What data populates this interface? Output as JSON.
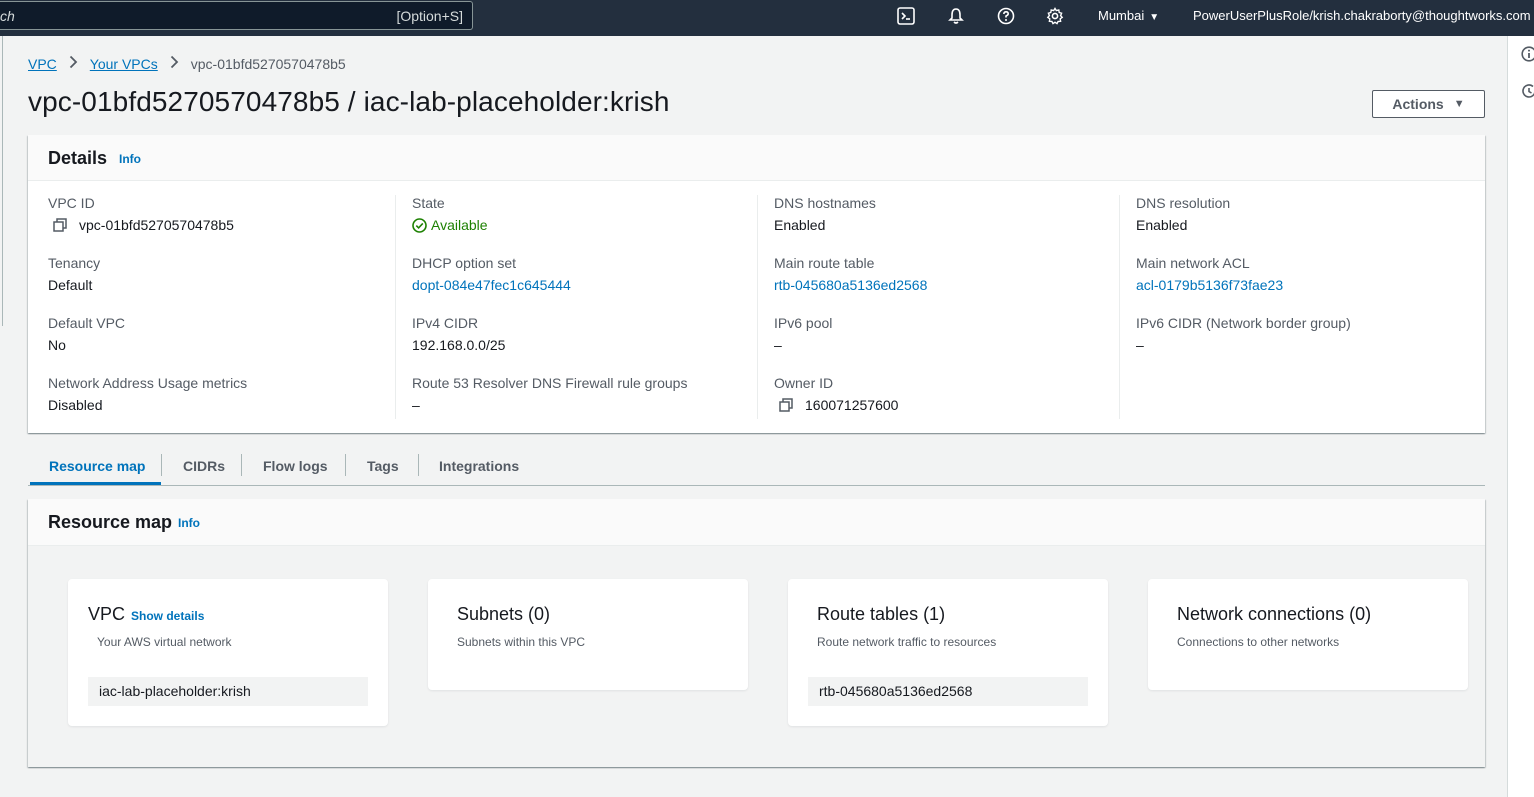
{
  "topnav": {
    "search_text": "ch",
    "search_shortcut": "[Option+S]",
    "region": "Mumbai",
    "account": "PowerUserPlusRole/krish.chakraborty@thoughtworks.com",
    "icons": [
      "cloudshell-icon",
      "bell-icon",
      "help-icon",
      "settings-icon"
    ]
  },
  "breadcrumb": {
    "items": [
      {
        "label": "VPC"
      },
      {
        "label": "Your VPCs"
      },
      {
        "label": "vpc-01bfd5270570478b5"
      }
    ]
  },
  "page": {
    "title": "vpc-01bfd5270570478b5 / iac-lab-placeholder:krish",
    "actions_label": "Actions"
  },
  "details": {
    "title": "Details",
    "info": "Info",
    "columns": [
      [
        {
          "label": "VPC ID",
          "value": "vpc-01bfd5270570478b5"
        },
        {
          "label": "Tenancy",
          "value": "Default"
        },
        {
          "label": "Default VPC",
          "value": "No"
        },
        {
          "label": "Network Address Usage metrics",
          "value": "Disabled"
        }
      ],
      [
        {
          "label": "State",
          "value": "Available"
        },
        {
          "label": "DHCP option set",
          "value": "dopt-084e47fec1c645444"
        },
        {
          "label": "IPv4 CIDR",
          "value": "192.168.0.0/25"
        },
        {
          "label": "Route 53 Resolver DNS Firewall rule groups",
          "value": "–"
        }
      ],
      [
        {
          "label": "DNS hostnames",
          "value": "Enabled"
        },
        {
          "label": "Main route table",
          "value": "rtb-045680a5136ed2568"
        },
        {
          "label": "IPv6 pool",
          "value": "–"
        },
        {
          "label": "Owner ID",
          "value": "160071257600"
        }
      ],
      [
        {
          "label": "DNS resolution",
          "value": "Enabled"
        },
        {
          "label": "Main network ACL",
          "value": "acl-0179b5136f73fae23"
        },
        {
          "label": "IPv6 CIDR (Network border group)",
          "value": "–"
        }
      ]
    ]
  },
  "tabs": [
    {
      "label": "Resource map"
    },
    {
      "label": "CIDRs"
    },
    {
      "label": "Flow logs"
    },
    {
      "label": "Tags"
    },
    {
      "label": "Integrations"
    }
  ],
  "resource_map": {
    "title": "Resource map",
    "info": "Info",
    "cards": [
      {
        "title": "VPC",
        "link": "Show details",
        "subtitle": "Your AWS virtual network",
        "chip": "iac-lab-placeholder:krish"
      },
      {
        "title": "Subnets (0)",
        "subtitle": "Subnets within this VPC"
      },
      {
        "title": "Route tables (1)",
        "subtitle": "Route network traffic to resources",
        "chip": "rtb-045680a5136ed2568"
      },
      {
        "title": "Network connections (0)",
        "subtitle": "Connections to other networks"
      }
    ]
  },
  "colors": {
    "nav_bg": "#232f3e",
    "link": "#0073bb",
    "success": "#1d8102",
    "page_bg": "#f2f3f3"
  }
}
